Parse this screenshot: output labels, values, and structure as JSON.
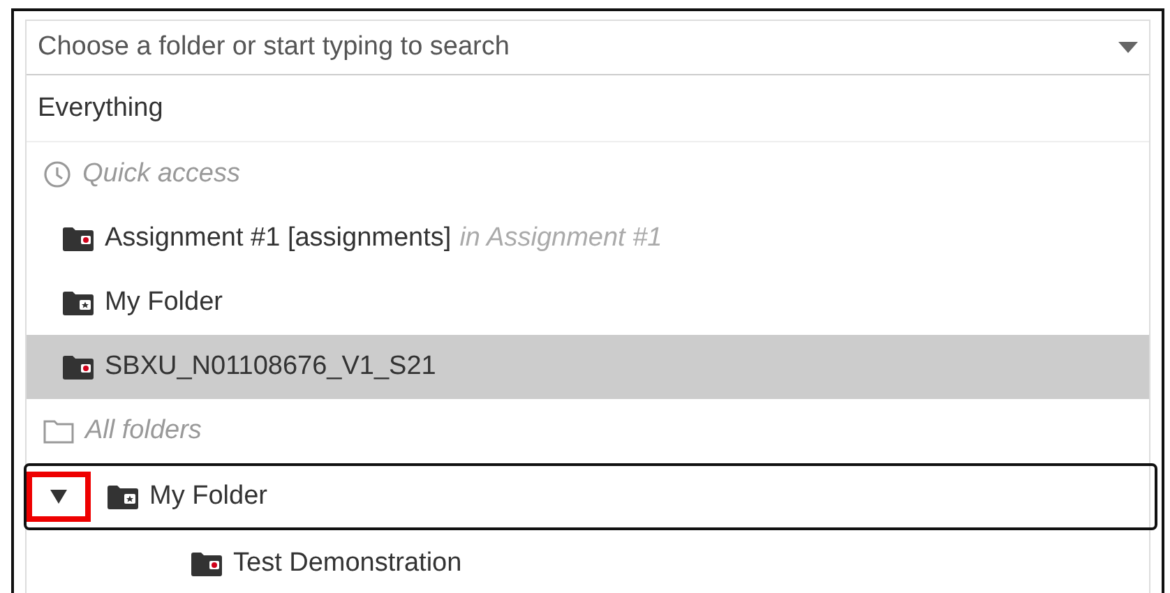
{
  "search": {
    "placeholder": "Choose a folder or start typing to search"
  },
  "everything": {
    "label": "Everything"
  },
  "quick_access": {
    "header": "Quick access",
    "items": [
      {
        "label": "Assignment #1 [assignments]",
        "location": "in Assignment #1",
        "kind": "assignment",
        "selected": false
      },
      {
        "label": "My Folder",
        "kind": "personal",
        "selected": false
      },
      {
        "label": "SBXU_N01108676_V1_S21",
        "kind": "assignment",
        "selected": true
      }
    ]
  },
  "all_folders": {
    "header": "All folders",
    "items": [
      {
        "label": "My Folder",
        "kind": "personal",
        "focused": true,
        "expanded": true,
        "toggle_highlighted": true,
        "children": [
          {
            "label": "Test Demonstration",
            "kind": "assignment",
            "focused": false
          }
        ]
      }
    ]
  }
}
